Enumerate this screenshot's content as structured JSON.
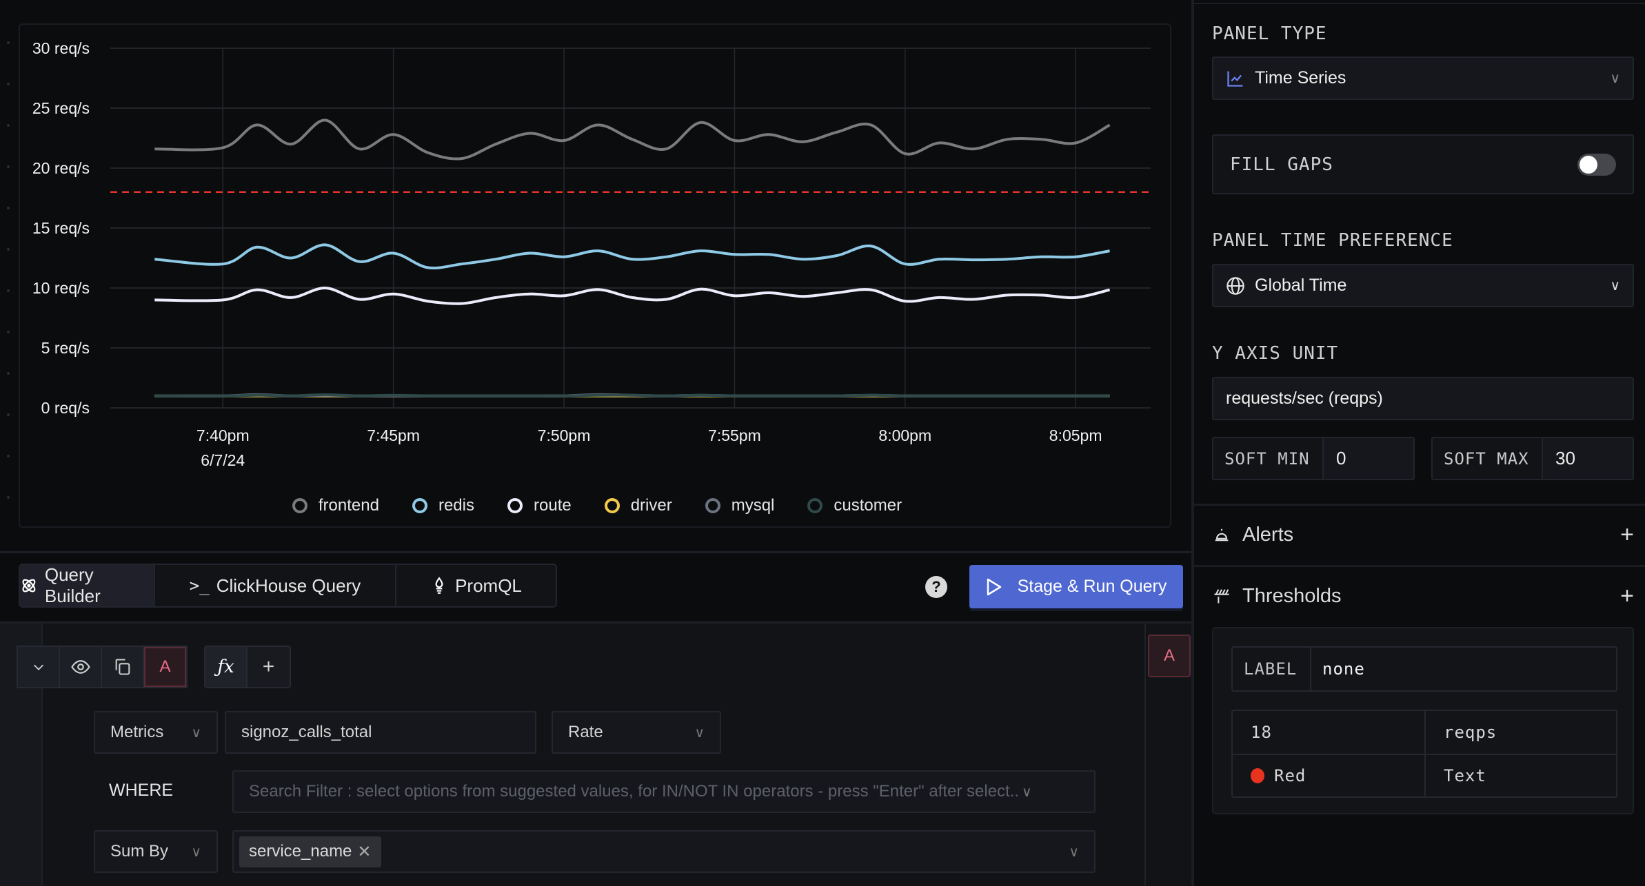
{
  "chart": {
    "threshold_color": "#e5332a"
  },
  "chart_data": {
    "type": "line",
    "title": "",
    "xlabel": "",
    "ylabel": "",
    "y_unit_suffix": " req/s",
    "ylim": [
      0,
      30
    ],
    "y_ticks": [
      "0 req/s",
      "5 req/s",
      "10 req/s",
      "15 req/s",
      "20 req/s",
      "25 req/s",
      "30 req/s"
    ],
    "y_tick_values": [
      0,
      5,
      10,
      15,
      20,
      25,
      30
    ],
    "x_ticks": [
      {
        "label": "7:40pm",
        "sub": "6/7/24",
        "minute": 40
      },
      {
        "label": "7:45pm",
        "sub": "",
        "minute": 45
      },
      {
        "label": "7:50pm",
        "sub": "",
        "minute": 50
      },
      {
        "label": "7:55pm",
        "sub": "",
        "minute": 55
      },
      {
        "label": "8:00pm",
        "sub": "",
        "minute": 60
      },
      {
        "label": "8:05pm",
        "sub": "",
        "minute": 65
      }
    ],
    "x_minutes": [
      38,
      40,
      41,
      42,
      43,
      44,
      45,
      46,
      47,
      48,
      49,
      50,
      51,
      52,
      53,
      54,
      55,
      56,
      57,
      58,
      59,
      60,
      61,
      62,
      63,
      64,
      65,
      66
    ],
    "xlim_minutes": [
      36.7,
      67.2
    ],
    "grid": true,
    "legend_position": "bottom",
    "threshold": {
      "value": 18,
      "unit": "reqps",
      "color": "Red",
      "style": "dashed"
    },
    "series": [
      {
        "name": "frontend",
        "color": "#7b7b7b",
        "values": [
          21.6,
          21.7,
          23.6,
          22.0,
          24.0,
          21.6,
          22.8,
          21.3,
          20.8,
          22.0,
          22.9,
          22.3,
          23.6,
          22.4,
          21.6,
          23.8,
          22.3,
          22.8,
          22.2,
          23.0,
          23.6,
          21.2,
          22.1,
          21.6,
          22.4,
          22.4,
          22.1,
          23.6
        ]
      },
      {
        "name": "redis",
        "color": "#8ecae6",
        "values": [
          12.4,
          12.0,
          13.4,
          12.5,
          13.6,
          12.2,
          12.9,
          11.7,
          12.0,
          12.4,
          12.9,
          12.6,
          13.1,
          12.4,
          12.6,
          13.1,
          12.8,
          12.8,
          12.4,
          12.7,
          13.5,
          12.0,
          12.4,
          12.35,
          12.4,
          12.6,
          12.6,
          13.1
        ]
      },
      {
        "name": "route",
        "color": "#ecebfa",
        "values": [
          9.0,
          9.0,
          9.85,
          9.2,
          10.0,
          9.05,
          9.5,
          8.9,
          8.7,
          9.2,
          9.5,
          9.35,
          9.87,
          9.2,
          9.05,
          9.9,
          9.35,
          9.6,
          9.3,
          9.6,
          9.85,
          8.9,
          9.2,
          9.05,
          9.4,
          9.4,
          9.2,
          9.85
        ]
      },
      {
        "name": "driver",
        "color": "#f2c94c",
        "values": [
          1.0,
          1.0,
          1.0,
          1.0,
          1.0,
          1.0,
          1.0,
          1.0,
          1.0,
          1.0,
          1.0,
          1.0,
          1.0,
          1.0,
          1.0,
          1.0,
          1.0,
          1.0,
          1.0,
          1.0,
          1.0,
          1.0,
          1.0,
          1.0,
          1.0,
          1.0,
          1.0,
          1.0
        ]
      },
      {
        "name": "mysql",
        "color": "#6b7280",
        "values": [
          1.0,
          1.0,
          1.1,
          1.0,
          1.05,
          1.0,
          1.0,
          1.0,
          1.0,
          1.0,
          1.0,
          1.0,
          1.1,
          1.05,
          1.0,
          1.05,
          1.0,
          1.0,
          1.0,
          1.0,
          1.05,
          1.0,
          1.0,
          1.0,
          1.0,
          1.0,
          1.0,
          1.0
        ]
      },
      {
        "name": "customer",
        "color": "#2f4a4a",
        "values": [
          1.0,
          1.0,
          1.05,
          1.0,
          1.1,
          1.0,
          1.05,
          1.0,
          1.0,
          1.0,
          1.0,
          1.0,
          1.05,
          1.05,
          1.0,
          1.05,
          1.0,
          1.0,
          1.0,
          1.0,
          1.05,
          1.0,
          1.0,
          1.0,
          1.0,
          1.0,
          1.0,
          1.0
        ]
      }
    ]
  },
  "legend": [
    {
      "name": "frontend",
      "color": "#7b7b7b"
    },
    {
      "name": "redis",
      "color": "#8ecae6"
    },
    {
      "name": "route",
      "color": "#ecebfa"
    },
    {
      "name": "driver",
      "color": "#f2c94c"
    },
    {
      "name": "mysql",
      "color": "#6b7280"
    },
    {
      "name": "customer",
      "color": "#2f4a4a"
    }
  ],
  "query_tabs": [
    {
      "label": "Query Builder",
      "icon": "atom-icon",
      "active": true
    },
    {
      "label": "ClickHouse Query",
      "icon": "terminal-icon",
      "active": false
    },
    {
      "label": "PromQL",
      "icon": "prometheus-icon",
      "active": false
    }
  ],
  "help_label": "?",
  "stage_run_label": "Stage & Run Query",
  "query": {
    "name": "A",
    "fx_label": "ƒx",
    "data_source": "Metrics",
    "metric": "signoz_calls_total",
    "aggregate": "Rate",
    "where_label": "WHERE",
    "where_placeholder": "Search Filter : select options from suggested values, for IN/NOT IN operators - press \"Enter\" after select..",
    "group_op": "Sum By",
    "group_chips": [
      "service_name"
    ]
  },
  "side_query_label": "A",
  "right_panel": {
    "panel_type_label": "PANEL TYPE",
    "panel_type_value": "Time Series",
    "fill_gaps_label": "FILL GAPS",
    "fill_gaps_on": false,
    "time_pref_label": "PANEL TIME PREFERENCE",
    "time_pref_value": "Global Time",
    "y_axis_unit_label": "Y AXIS UNIT",
    "y_axis_unit_value": "requests/sec (reqps)",
    "soft_min_label": "SOFT MIN",
    "soft_min_value": "0",
    "soft_max_label": "SOFT MAX",
    "soft_max_value": "30",
    "alerts_label": "Alerts",
    "thresholds_label": "Thresholds",
    "threshold": {
      "label_key": "LABEL",
      "label_value": "none",
      "value": "18",
      "unit": "reqps",
      "color_name": "Red",
      "color_hex": "#e8331f",
      "format": "Text"
    }
  }
}
